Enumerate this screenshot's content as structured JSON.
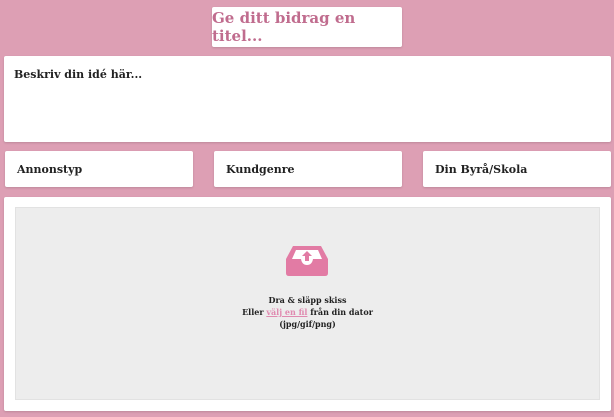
{
  "title_input": {
    "placeholder": "Ge ditt bidrag en titel..."
  },
  "description": {
    "placeholder": "Beskriv din idé här..."
  },
  "fields": [
    {
      "label": "Annonstyp"
    },
    {
      "label": "Kundgenre"
    },
    {
      "label": "Din Byrå/Skola"
    }
  ],
  "upload": {
    "icon": "upload-tray-icon",
    "line1": "Dra & släpp skiss",
    "line2_prefix": "Eller ",
    "line2_link": "välj en fil",
    "line2_suffix": " från din dator",
    "line3": "(jpg/gif/png)"
  },
  "colors": {
    "background": "#dd9fb4",
    "accent": "#c06c8e",
    "link": "#e08ab0",
    "icon": "#e27ba4"
  }
}
